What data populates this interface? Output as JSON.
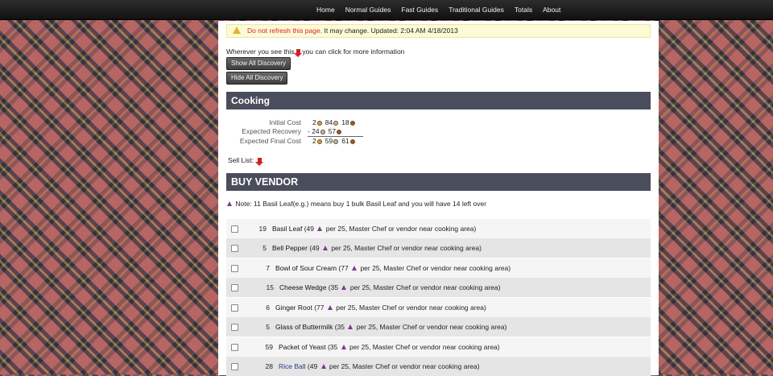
{
  "nav": [
    "Home",
    "Normal Guides",
    "Fast Guides",
    "Traditional Guides",
    "Totals",
    "About"
  ],
  "warning": {
    "red_text": "Do not refresh this page.",
    "text": " It may change. Updated: 2:04 AM 4/18/2013"
  },
  "discovery": {
    "prefix": "Wherever you see this",
    "suffix": "you can click for more information",
    "show_label": "Show All Discovery",
    "hide_label": "Hide All Discovery"
  },
  "cooking": {
    "title": "Cooking",
    "costs": [
      {
        "label": "Initial Cost",
        "sign": "",
        "gold": "2",
        "silver": "84",
        "copper": "18"
      },
      {
        "label": "Expected Recovery",
        "sign": "- ",
        "gold": "",
        "silver": "24",
        "copper": "57"
      },
      {
        "label": "Expected Final Cost",
        "sign": "",
        "gold": "2",
        "silver": "59",
        "copper": "61"
      }
    ],
    "sell_list_label": "Sell List:"
  },
  "vendor": {
    "title": "BUY VENDOR",
    "note": "Note: 11 Basil Leaf(e.g.) means buy 1 bulk Basil Leaf and you will have 14 left over",
    "items": [
      {
        "qty": "19",
        "name": "Basil Leaf",
        "pre": " (49 ",
        "post": " per 25, Master Chef or vendor near cooking area)",
        "link": false
      },
      {
        "qty": "5",
        "name": "Bell Pepper",
        "pre": " (49 ",
        "post": " per 25, Master Chef or vendor near cooking area)",
        "link": false
      },
      {
        "qty": "7",
        "name": "Bowl of Sour Cream",
        "pre": " (77 ",
        "post": " per 25, Master Chef or vendor near cooking area)",
        "link": false
      },
      {
        "qty": "15",
        "name": "Cheese Wedge",
        "pre": " (35 ",
        "post": " per 25, Master Chef or vendor near cooking area)",
        "link": false
      },
      {
        "qty": "6",
        "name": "Ginger Root",
        "pre": " (77 ",
        "post": " per 25, Master Chef or vendor near cooking area)",
        "link": false
      },
      {
        "qty": "5",
        "name": "Glass of Buttermilk",
        "pre": " (35 ",
        "post": " per 25, Master Chef or vendor near cooking area)",
        "link": false
      },
      {
        "qty": "59",
        "name": "Packet of Yeast",
        "pre": " (35 ",
        "post": " per 25, Master Chef or vendor near cooking area)",
        "link": false
      },
      {
        "qty": "28",
        "name": "Rice Ball",
        "pre": " (49 ",
        "post": " per 25, Master Chef or vendor near cooking area)",
        "link": true
      }
    ]
  },
  "colors": {
    "nav_bg": "#1c1c1c",
    "section_bar": "#4a4e5c",
    "warning_bg": "#fdfbd6",
    "warning_red": "#d9232a",
    "row_alt": "#e5e5e5",
    "arrow_red": "#d21f26",
    "note_purple": "#7d3b8c"
  }
}
